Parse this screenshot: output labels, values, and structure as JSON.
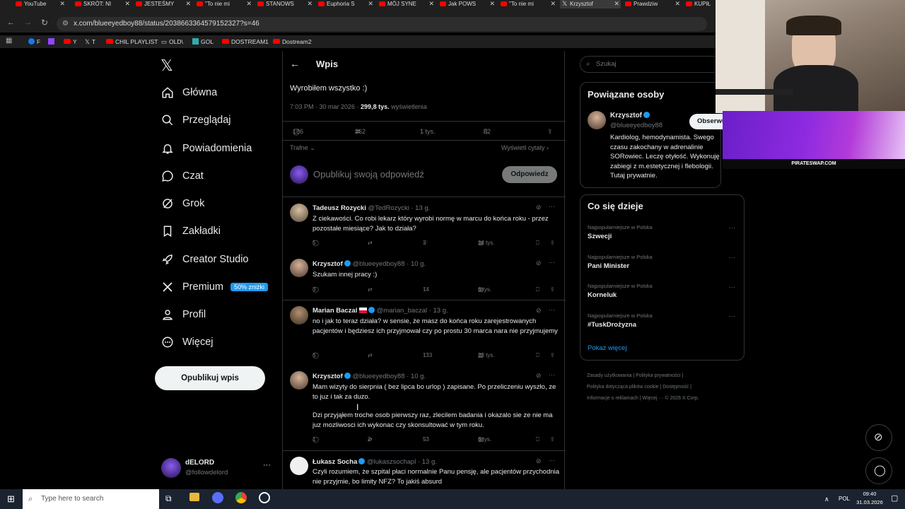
{
  "browser": {
    "tabs": [
      {
        "label": "YouTube",
        "active": false
      },
      {
        "label": "SKRÓT: NI",
        "active": false
      },
      {
        "label": "JESTEŚMY",
        "active": false
      },
      {
        "label": "\"To nie mi",
        "active": false
      },
      {
        "label": "STANOWS",
        "active": false
      },
      {
        "label": "Euphoria S",
        "active": false
      },
      {
        "label": "MÓJ SYNE",
        "active": false
      },
      {
        "label": "Jak POWS",
        "active": false
      },
      {
        "label": "\"To nie mi",
        "active": false
      },
      {
        "label": "Krzysztof",
        "active": true
      },
      {
        "label": "Prawdziw",
        "active": false
      },
      {
        "label": "KUPIŁ",
        "active": false
      }
    ],
    "url": "x.com/blueeyedboy88/status/2038663364579152327?s=46",
    "bookmarks": [
      "F",
      "Y",
      "T",
      "CHIL PLAYLIST",
      "OLD\\",
      "GOL",
      "DOSTREAM1",
      "Dostream2"
    ]
  },
  "sidebar": {
    "items": [
      {
        "label": "Główna",
        "icon": "home-icon"
      },
      {
        "label": "Przeglądaj",
        "icon": "search-icon"
      },
      {
        "label": "Powiadomienia",
        "icon": "bell-icon"
      },
      {
        "label": "Czat",
        "icon": "chat-icon"
      },
      {
        "label": "Grok",
        "icon": "grok-icon"
      },
      {
        "label": "Zakładki",
        "icon": "bookmark-icon"
      },
      {
        "label": "Creator Studio",
        "icon": "rocket-icon"
      },
      {
        "label": "Premium",
        "icon": "x-logo-icon",
        "badge": "50% zniżki"
      },
      {
        "label": "Profil",
        "icon": "person-icon"
      },
      {
        "label": "Więcej",
        "icon": "more-circle-icon"
      }
    ],
    "post_button": "Opublikuj wpis",
    "account": {
      "name": "dELORD",
      "handle": "@followdelord"
    }
  },
  "post": {
    "header": "Wpis",
    "text": "Wyrobiłem wszystko :)",
    "time": "7:03 PM · 30 mar 2026 · ",
    "views_bold": "299,8 tys.",
    "views_label": " wyświetlenia",
    "stats": {
      "replies": "186",
      "reposts": "362",
      "likes": "1 tys.",
      "bookmarks": "82"
    },
    "sort": "Trafne",
    "quotes": "Wyświetl cytaty",
    "reply_placeholder": "Opublikuj swoją odpowiedź",
    "reply_button": "Odpowiedz"
  },
  "replies": [
    {
      "name": "Tadeusz Rozycki",
      "handle": "@TedRozycki · 13 g.",
      "verified": false,
      "text": "Z ciekawości. Co robi lekarz który wyrobi normę w marcu do końca roku - przez pozostałe miesiące?  Jak to działa?",
      "replies": "5",
      "reposts": "",
      "likes": "3",
      "views": "14 tys."
    },
    {
      "name": "Krzysztof",
      "handle": "@blueeyedboy88 · 10 g.",
      "verified": true,
      "text": "Szukam innej pracy :)",
      "replies": "3",
      "reposts": "",
      "likes": "14",
      "views": "6 tys."
    },
    {
      "name": "Marian Baczal",
      "handle": "@marian_baczal · 13 g.",
      "verified": true,
      "text": "no i jak to teraz działa? w sensie, że masz do końca roku zarejestrowanych pacjentów i będziesz ich przyjmował czy po prostu 30 marca nara nie przyjmujemy",
      "replies": "6",
      "reposts": "",
      "likes": "133",
      "views": "23 tys."
    },
    {
      "name": "Krzysztof",
      "handle": "@blueeyedboy88 · 10 g.",
      "verified": true,
      "text": "Mam wizyty do sierpnia ( bez lipca bo urlop ) zapisane. Po przeliczeniu wyszło, ze to juz i tak za duzo.",
      "text2": "Dzi przyjąłem troche osob pierwszy raz, zlecilem badania i okazalo sie ze nie ma juz mozliwosci ich wykonac czy skonsultować w tym roku.",
      "replies": "1",
      "reposts": "2",
      "likes": "53",
      "views": "6 tys."
    },
    {
      "name": "Łukasz Socha",
      "handle": "@lukaszsochapl · 13 g.",
      "verified": true,
      "text": "Czyli rozumiem, że szpital płaci normalnie Panu pensję, ale pacjentów przychodnia nie przyjmie, bo limity NFZ? To jakiś absurd"
    }
  ],
  "right": {
    "search_placeholder": "Szukaj",
    "related_title": "Powiązane osoby",
    "person": {
      "name": "Krzysztof",
      "handle": "@blueeyedboy88",
      "follow": "Obserwuj",
      "bio": "Kardiolog, hemodynamista. Swego czasu zakochany w adrenalinie SORowiec. Leczę otyłość. Wykonuję zabiegi z m.estetycznej i flebologii. Tutaj prywatnie."
    },
    "trends_title": "Co się dzieje",
    "trends": [
      {
        "meta": "Najpopularniejsze w Polska",
        "name": "Szwecji"
      },
      {
        "meta": "Najpopularniejsze w Polska",
        "name": "Pani Minister"
      },
      {
        "meta": "Najpopularniejsze w Polska",
        "name": "Korneluk"
      },
      {
        "meta": "Najpopularniejsze w Polska",
        "name": "#TuskDrożyzna"
      }
    ],
    "show_more": "Pokaż więcej",
    "footer": [
      "Zasady użytkowania  |  Polityka prywatności  |",
      "Polityka dotycząca plików cookie  |  Dostępność  |",
      "Informacje o reklamach  |  Więcej ···  © 2026 X Corp."
    ]
  },
  "overlay": {
    "banner_text": "PIRATESWAP.COM"
  },
  "taskbar": {
    "search_placeholder": "Type here to search",
    "lang": "POL",
    "time": "09:40",
    "date": "31.03.2026"
  },
  "colors": {
    "accent": "#1d9bf0",
    "bg": "#000000",
    "border": "#2f3336",
    "muted": "#71767b",
    "text": "#e7e9ea"
  }
}
